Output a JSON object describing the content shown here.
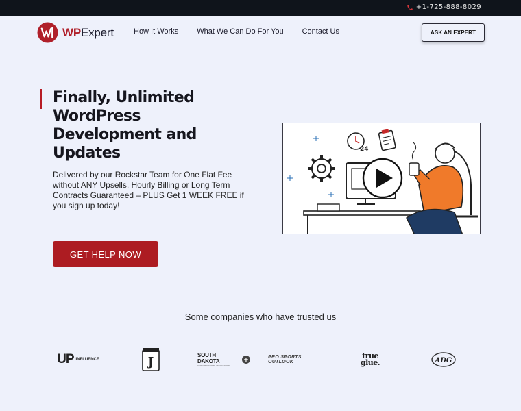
{
  "topbar": {
    "phone": "+1-725-888-8029",
    "phone_icon": "phone-icon"
  },
  "brand": {
    "prefix": "WP",
    "suffix": "Expert",
    "accent_color": "#b0202a"
  },
  "nav": [
    {
      "label": "How It Works"
    },
    {
      "label": "What We Can Do For You"
    },
    {
      "label": "Contact Us"
    }
  ],
  "header": {
    "cta_label": "ASK AN EXPERT"
  },
  "hero": {
    "title": "Finally, Unlimited WordPress Development and Updates",
    "subtitle": "Delivered by our Rockstar Team for One Flat Fee without ANY Upsells, Hourly Billing or Long Term Contracts Guaranteed – PLUS Get 1 WEEK FREE if you sign up today!",
    "cta_label": "GET HELP NOW",
    "cta_color": "#ad1c22",
    "video": {
      "icon": "play-icon",
      "clock_label": "24"
    }
  },
  "trusted": {
    "heading": "Some companies who have trusted us",
    "logos": [
      {
        "big": "UP",
        "small": "INFLUENCE"
      },
      {
        "mark": "J"
      },
      {
        "top": "SOUTH DAKOTA",
        "bottom": "CHIROPRACTORS ASSOCIATION"
      },
      {
        "text": "PRO SPORTS OUTLOOK"
      },
      {
        "line1": "true",
        "line2": "glue."
      },
      {
        "text": "ADG"
      }
    ]
  }
}
